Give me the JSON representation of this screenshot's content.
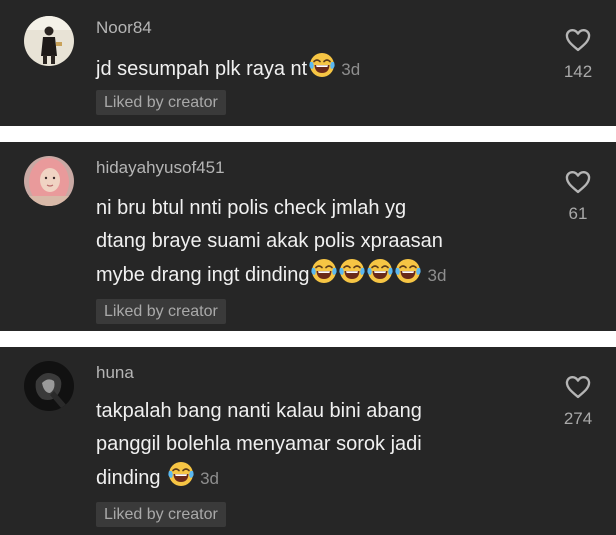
{
  "comments": [
    {
      "username": "Noor84",
      "lines": [
        "jd sesumpah plk raya nt"
      ],
      "time": "3d",
      "liked_label": "Liked by creator",
      "likes": "142",
      "icons": [
        "avatar-photo",
        "heart-outline-icon",
        "face-with-tears-of-joy-emoji"
      ]
    },
    {
      "username": "hidayahyusof451",
      "lines": [
        "ni bru btul nnti polis check jmlah yg",
        "dtang braye suami akak polis xpraasan",
        "mybe drang ingt dinding"
      ],
      "time": "3d",
      "liked_label": "Liked by creator",
      "likes": "61",
      "icons": [
        "avatar-photo",
        "heart-outline-icon",
        "face-with-tears-of-joy-emoji"
      ]
    },
    {
      "username": "huna",
      "lines": [
        "takpalah bang nanti kalau bini abang",
        "panggil bolehla menyamar sorok jadi",
        "dinding"
      ],
      "time": "3d",
      "liked_label": "Liked by creator",
      "likes": "274",
      "icons": [
        "avatar-photo",
        "heart-outline-icon",
        "face-with-tears-of-joy-emoji"
      ]
    }
  ],
  "colors": {
    "card_background": "#262626",
    "separator": "#ffffff",
    "comment_text": "#f0f0f0",
    "secondary_text": "#a9a9a9",
    "badge_background": "#3a3a3a"
  }
}
